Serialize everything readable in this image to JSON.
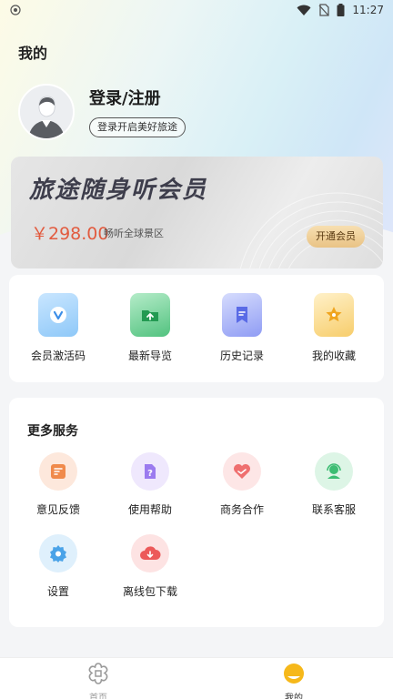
{
  "status_bar": {
    "time": "11:27"
  },
  "header": {
    "title": "我的"
  },
  "profile": {
    "login_label": "登录/注册",
    "login_subtitle": "登录开启美好旅途"
  },
  "vip": {
    "title": "旅途随身听会员",
    "price": "￥298.00",
    "description": "畅听全球景区",
    "button_label": "开通会员"
  },
  "quick_actions": [
    {
      "label": "会员激活码",
      "icon": "vip-code-icon",
      "color": "#5aa9f5"
    },
    {
      "label": "最新导览",
      "icon": "new-guide-icon",
      "color": "#37b56a"
    },
    {
      "label": "历史记录",
      "icon": "history-icon",
      "color": "#6e7ff0"
    },
    {
      "label": "我的收藏",
      "icon": "favorite-star-icon",
      "color": "#f3b43a"
    }
  ],
  "more_services": {
    "title": "更多服务",
    "items": [
      {
        "label": "意见反馈",
        "icon": "feedback-icon",
        "color": "#f08a4b"
      },
      {
        "label": "使用帮助",
        "icon": "help-icon",
        "color": "#9b7bef"
      },
      {
        "label": "商务合作",
        "icon": "heart-handshake-icon",
        "color": "#ef6f6f"
      },
      {
        "label": "联系客服",
        "icon": "customer-service-icon",
        "color": "#3dbd73"
      },
      {
        "label": "设置",
        "icon": "settings-gear-icon",
        "color": "#4aa3e8"
      },
      {
        "label": "离线包下载",
        "icon": "cloud-download-icon",
        "color": "#ec5a5a"
      }
    ]
  },
  "bottom_nav": [
    {
      "label": "首页",
      "icon": "home-flower-icon",
      "active": false
    },
    {
      "label": "我的",
      "icon": "profile-smile-icon",
      "active": true
    }
  ]
}
